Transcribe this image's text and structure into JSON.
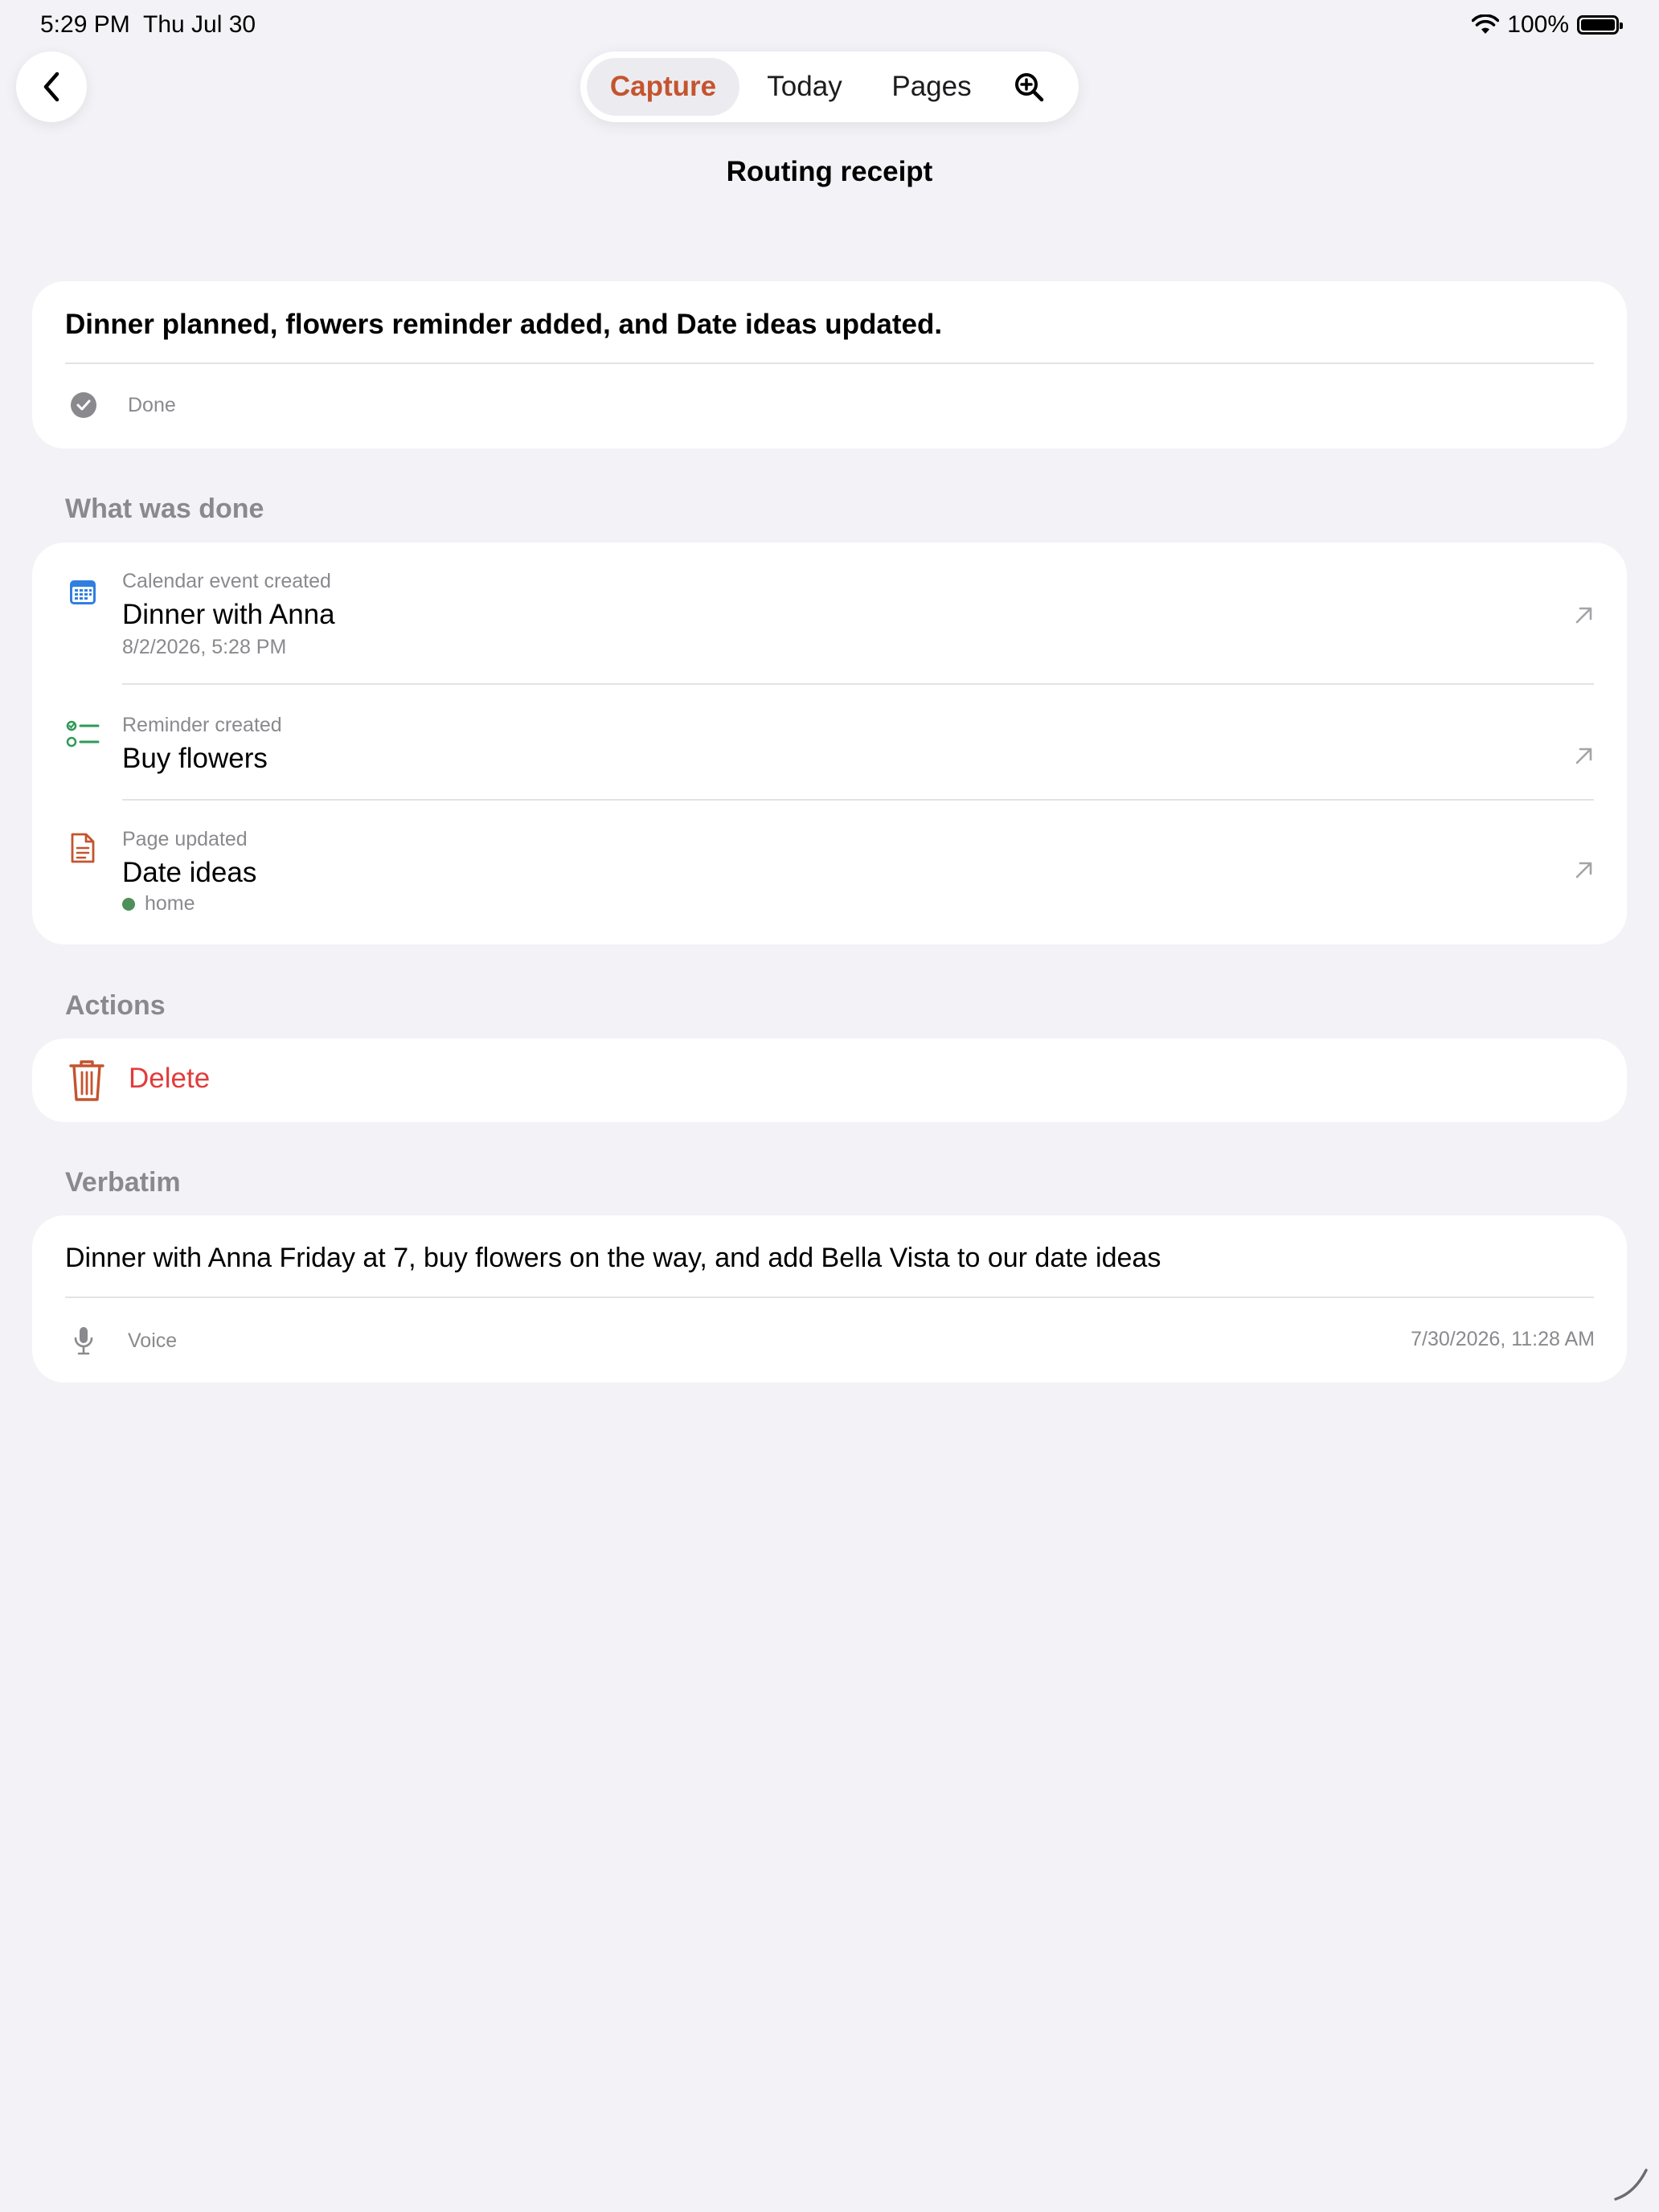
{
  "status_bar": {
    "time": "5:29 PM",
    "date": "Thu Jul 30",
    "battery": "100%"
  },
  "nav": {
    "tabs": [
      {
        "label": "Capture",
        "active": true
      },
      {
        "label": "Today",
        "active": false
      },
      {
        "label": "Pages",
        "active": false
      }
    ],
    "search_icon": "magnifier-plus-icon",
    "back_icon": "chevron-left-icon"
  },
  "page_title": "Routing receipt",
  "summary": {
    "text": "Dinner planned, flowers reminder added, and Date ideas updated.",
    "status": "Done"
  },
  "what_was_done": {
    "label": "What was done",
    "items": [
      {
        "kind": "Calendar event created",
        "title": "Dinner with Anna",
        "detail": "8/2/2026, 5:28 PM",
        "icon": "calendar-icon"
      },
      {
        "kind": "Reminder created",
        "title": "Buy flowers",
        "icon": "checklist-icon"
      },
      {
        "kind": "Page updated",
        "title": "Date ideas",
        "tag": "home",
        "icon": "document-icon"
      }
    ]
  },
  "actions": {
    "label": "Actions",
    "delete_label": "Delete"
  },
  "verbatim": {
    "label": "Verbatim",
    "text": "Dinner with Anna Friday at 7, buy flowers on the way, and add Bella Vista to our date ideas",
    "source": "Voice",
    "timestamp": "7/30/2026, 11:28 AM"
  },
  "colors": {
    "accent": "#c4542f",
    "destructive": "#e23b3b",
    "calendar": "#2f7fe0",
    "reminder": "#2e9a58",
    "tag_home": "#4f8f5a",
    "background": "#f2f2f7"
  }
}
